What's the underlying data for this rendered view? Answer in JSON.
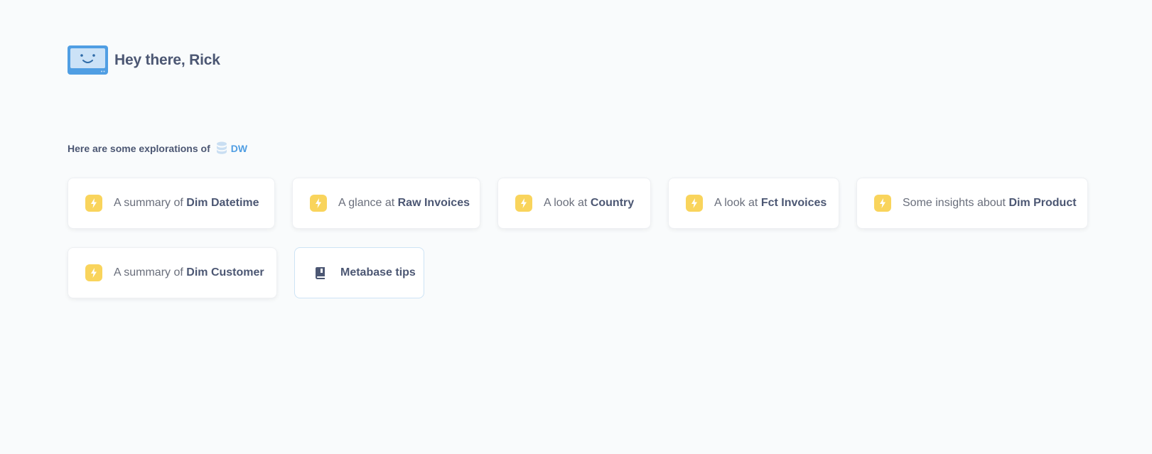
{
  "greeting": {
    "text": "Hey there, Rick",
    "mascot": "smiling-monitor-icon"
  },
  "explorations": {
    "intro": "Here are some explorations of",
    "database_name": "DW",
    "database_icon": "database-icon",
    "items": [
      {
        "prefix": "A summary of",
        "entity": "Dim Datetime",
        "icon": "bolt-icon"
      },
      {
        "prefix": "A glance at",
        "entity": "Raw Invoices",
        "icon": "bolt-icon"
      },
      {
        "prefix": "A look at",
        "entity": "Country",
        "icon": "bolt-icon"
      },
      {
        "prefix": "A look at",
        "entity": "Fct Invoices",
        "icon": "bolt-icon"
      },
      {
        "prefix": "Some insights about",
        "entity": "Dim Product",
        "icon": "bolt-icon"
      },
      {
        "prefix": "A summary of",
        "entity": "Dim Customer",
        "icon": "bolt-icon"
      }
    ],
    "tips_card": {
      "label": "Metabase tips",
      "icon": "book-icon"
    }
  },
  "colors": {
    "background": "#f9fbfc",
    "text": "#4c5773",
    "muted_text": "#696e7b",
    "brand": "#509ee3",
    "bolt": "#f9d45c"
  }
}
